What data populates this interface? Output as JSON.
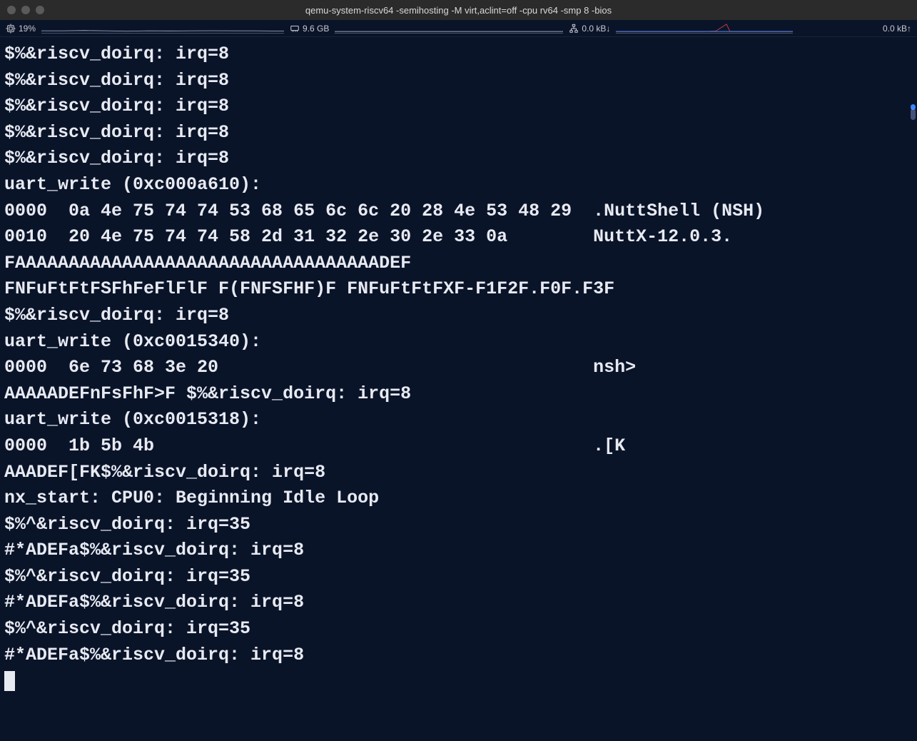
{
  "window": {
    "title": "qemu-system-riscv64 -semihosting -M virt,aclint=off -cpu rv64 -smp 8 -bios"
  },
  "statusbar": {
    "cpu_percent": "19%",
    "mem_value": "9.6 GB",
    "net_down": "0.0 kB↓",
    "net_up": "0.0 kB↑"
  },
  "terminal": {
    "lines": [
      "$%&riscv_doirq: irq=8",
      "$%&riscv_doirq: irq=8",
      "$%&riscv_doirq: irq=8",
      "$%&riscv_doirq: irq=8",
      "$%&riscv_doirq: irq=8",
      "uart_write (0xc000a610):",
      "0000  0a 4e 75 74 74 53 68 65 6c 6c 20 28 4e 53 48 29  .NuttShell (NSH)",
      "0010  20 4e 75 74 74 58 2d 31 32 2e 30 2e 33 0a        NuttX-12.0.3.",
      "FAAAAAAAAAAAAAAAAAAAAAAAAAAAAAAAAAADEF",
      "FNFuFtFtFSFhFeFlFlF F(FNFSFHF)F FNFuFtFtFXF-F1F2F.F0F.F3F",
      "$%&riscv_doirq: irq=8",
      "uart_write (0xc0015340):",
      "0000  6e 73 68 3e 20                                   nsh> ",
      "AAAAADEFnFsFhF>F $%&riscv_doirq: irq=8",
      "uart_write (0xc0015318):",
      "0000  1b 5b 4b                                         .[K",
      "AAADEF[FK$%&riscv_doirq: irq=8",
      "nx_start: CPU0: Beginning Idle Loop",
      "$%^&riscv_doirq: irq=35",
      "#*ADEFa$%&riscv_doirq: irq=8",
      "$%^&riscv_doirq: irq=35",
      "#*ADEFa$%&riscv_doirq: irq=8",
      "$%^&riscv_doirq: irq=35",
      "#*ADEFa$%&riscv_doirq: irq=8"
    ]
  }
}
